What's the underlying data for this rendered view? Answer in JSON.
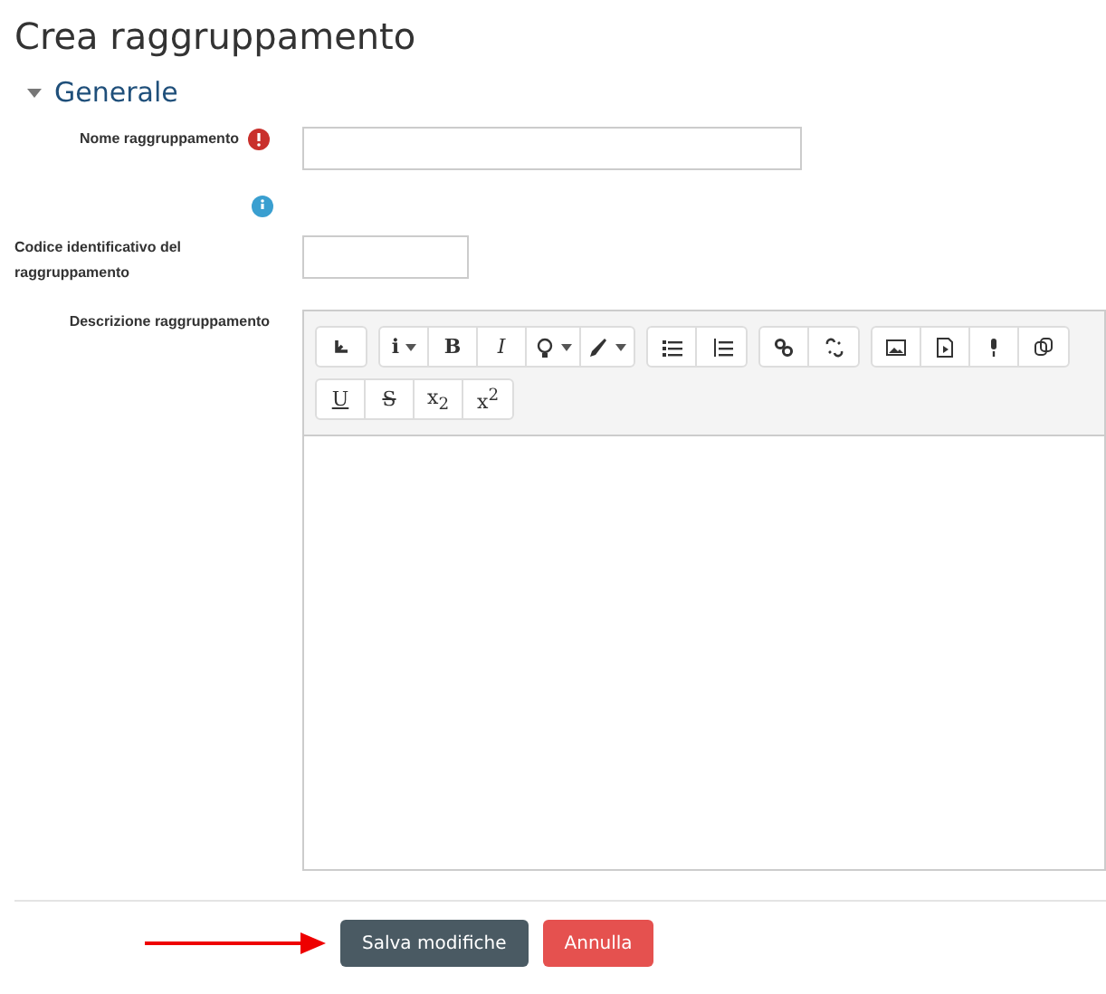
{
  "page_title": "Crea raggruppamento",
  "section": {
    "title": "Generale",
    "expanded": true
  },
  "fields": [
    {
      "kind": "text",
      "label": "Nome raggruppamento",
      "required": true,
      "help": false
    },
    {
      "kind": "short",
      "label": "Codice identificativo del raggruppamento",
      "required": false,
      "help": true
    },
    {
      "kind": "editor",
      "label": "Descrizione raggruppamento",
      "required": false,
      "help": false
    }
  ],
  "toolbar_rows": [
    [
      {
        "items": [
          {
            "kind": "icon"
          }
        ]
      },
      {
        "items": [
          {
            "kind": "info",
            "label": "i",
            "dropdown": true
          },
          {
            "kind": "bold",
            "label": "B",
            "dropdown": false
          },
          {
            "kind": "italic",
            "label": "I",
            "dropdown": false
          },
          {
            "kind": "icon",
            "dropdown": true
          },
          {
            "kind": "icon",
            "dropdown": true
          }
        ]
      },
      {
        "items": [
          {
            "kind": "icon"
          },
          {
            "kind": "icon"
          }
        ]
      },
      {
        "items": [
          {
            "kind": "icon"
          },
          {
            "kind": "icon"
          }
        ]
      },
      {
        "items": [
          {
            "kind": "icon"
          },
          {
            "kind": "icon"
          },
          {
            "kind": "icon"
          },
          {
            "kind": "icon"
          }
        ]
      }
    ],
    [
      {
        "items": [
          {
            "kind": "underline",
            "label": "U",
            "dropdown": false
          },
          {
            "kind": "strike",
            "label": "S",
            "dropdown": false
          },
          {
            "kind": "plain",
            "label": "x$_{2}$",
            "dropdown": false
          },
          {
            "kind": "plain",
            "label": "x$^{2}$",
            "dropdown": false
          }
        ]
      }
    ]
  ],
  "buttons": [
    {
      "kind": "primary",
      "label": "Salva modifiche"
    },
    {
      "kind": "danger",
      "label": "Annulla"
    }
  ]
}
